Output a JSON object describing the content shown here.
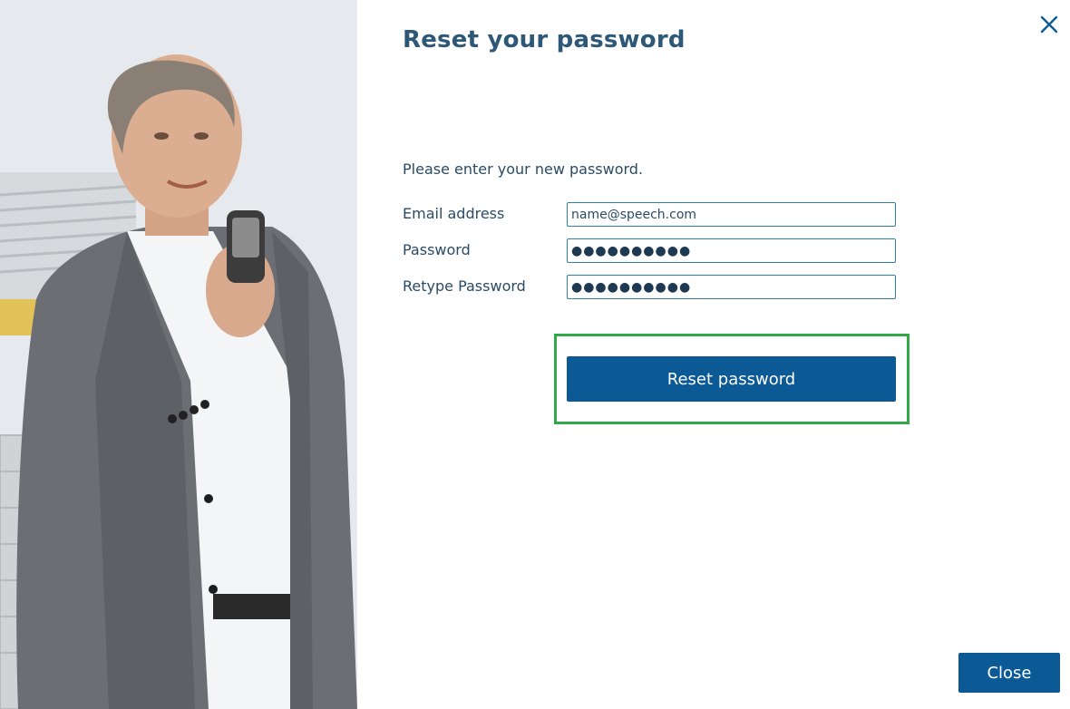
{
  "dialog": {
    "title": "Reset your password",
    "instruction": "Please enter your new password.",
    "close_icon": "close-x-icon"
  },
  "form": {
    "email": {
      "label": "Email address",
      "value": "name@speech.com"
    },
    "password": {
      "label": "Password",
      "masked_value": "●●●●●●●●●●"
    },
    "retype": {
      "label": "Retype Password",
      "masked_value": "●●●●●●●●●●"
    },
    "submit_label": "Reset password"
  },
  "footer": {
    "close_label": "Close"
  },
  "colors": {
    "title": "#2d5877",
    "primary": "#0b5a96",
    "field_border": "#2c7fa6",
    "highlight": "#2eaa48"
  }
}
